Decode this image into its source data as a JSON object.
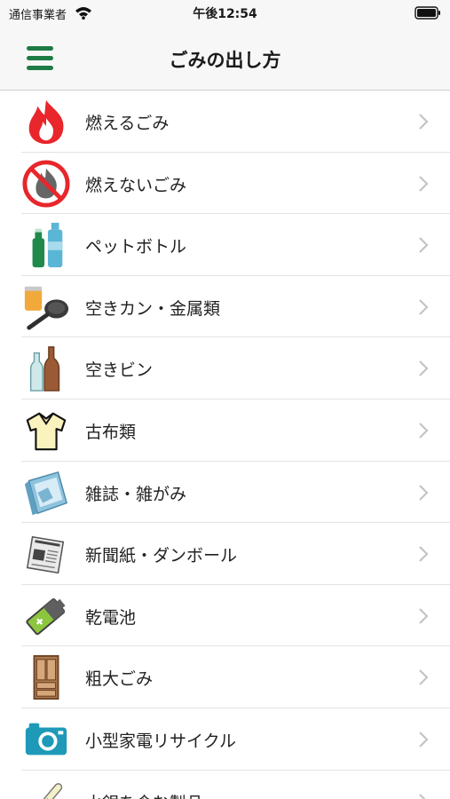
{
  "status": {
    "carrier": "通信事業者",
    "time": "午後12:54"
  },
  "header": {
    "title": "ごみの出し方",
    "accent": "#1e7b45"
  },
  "items": [
    {
      "label": "燃えるごみ",
      "icon": "fire-icon"
    },
    {
      "label": "燃えないごみ",
      "icon": "no-burn-icon"
    },
    {
      "label": "ペットボトル",
      "icon": "pet-bottle-icon"
    },
    {
      "label": "空きカン・金属類",
      "icon": "can-pan-icon"
    },
    {
      "label": "空きビン",
      "icon": "glass-bottle-icon"
    },
    {
      "label": "古布類",
      "icon": "shirt-icon"
    },
    {
      "label": "雑誌・雑がみ",
      "icon": "magazine-icon"
    },
    {
      "label": "新聞紙・ダンボール",
      "icon": "newspaper-icon"
    },
    {
      "label": "乾電池",
      "icon": "battery-icon"
    },
    {
      "label": "粗大ごみ",
      "icon": "cabinet-icon"
    },
    {
      "label": "小型家電リサイクル",
      "icon": "camera-icon"
    },
    {
      "label": "水銀を含む製品",
      "icon": "thermometer-icon"
    }
  ]
}
